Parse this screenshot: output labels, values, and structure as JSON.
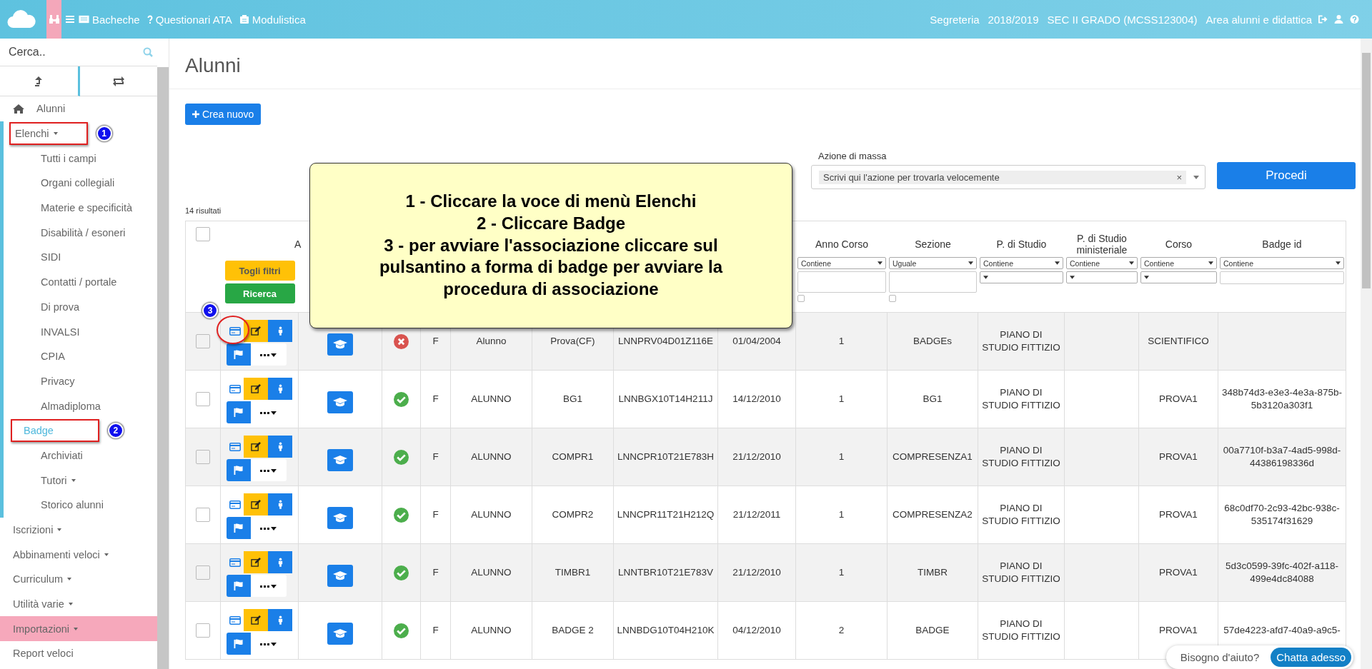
{
  "topbar": {
    "nav": [
      {
        "kind": "board",
        "label": "Bacheche"
      },
      {
        "kind": "question",
        "label": "Questionari ATA"
      },
      {
        "kind": "doc",
        "label": "Modulistica"
      }
    ],
    "info": [
      "Segreteria",
      "2018/2019",
      "SEC II GRADO (MCSS123004)",
      "Area alunni e didattica"
    ]
  },
  "sidebar": {
    "search_placeholder": "Cerca..",
    "tabs": [
      {
        "kind": "up",
        "selected": true
      },
      {
        "kind": "swap",
        "selected": false
      }
    ],
    "items": [
      {
        "label": "Alunni",
        "kind": "home",
        "dropdown": false,
        "selected": false,
        "highlighted": false
      },
      {
        "label": "Elenchi",
        "dropdown": true,
        "expanded": true,
        "selected": false,
        "highlighted": false,
        "annotation": "1",
        "children": [
          {
            "label": "Tutti i campi",
            "selected": false,
            "dropdown": false
          },
          {
            "label": "Organi collegiali",
            "selected": false,
            "dropdown": false
          },
          {
            "label": "Materie e specificità",
            "selected": false,
            "dropdown": false
          },
          {
            "label": "Disabilità / esoneri",
            "selected": false,
            "dropdown": false
          },
          {
            "label": "SIDI",
            "selected": false,
            "dropdown": false
          },
          {
            "label": "Contatti / portale",
            "selected": false,
            "dropdown": false
          },
          {
            "label": "Di prova",
            "selected": false,
            "dropdown": false
          },
          {
            "label": "INVALSI",
            "selected": false,
            "dropdown": false
          },
          {
            "label": "CPIA",
            "selected": false,
            "dropdown": false
          },
          {
            "label": "Privacy",
            "selected": false,
            "dropdown": false
          },
          {
            "label": "Almadiploma",
            "selected": false,
            "dropdown": false
          },
          {
            "label": "Badge",
            "selected": true,
            "dropdown": false,
            "annotation": "2"
          },
          {
            "label": "Archiviati",
            "selected": false,
            "dropdown": false
          },
          {
            "label": "Tutori",
            "selected": false,
            "dropdown": true
          },
          {
            "label": "Storico alunni",
            "selected": false,
            "dropdown": false
          }
        ]
      },
      {
        "label": "Iscrizioni",
        "dropdown": true,
        "selected": false,
        "highlighted": false
      },
      {
        "label": "Abbinamenti veloci",
        "dropdown": true,
        "selected": false,
        "highlighted": false
      },
      {
        "label": "Curriculum",
        "dropdown": true,
        "selected": false,
        "highlighted": false
      },
      {
        "label": "Utilità varie",
        "dropdown": true,
        "selected": false,
        "highlighted": false
      },
      {
        "label": "Importazioni",
        "dropdown": true,
        "selected": false,
        "highlighted": true
      },
      {
        "label": "Report veloci",
        "dropdown": false,
        "selected": false,
        "highlighted": false
      }
    ]
  },
  "page": {
    "title": "Alunni",
    "create_button": "Crea nuovo",
    "mass_action": {
      "label": "Azione di massa",
      "value": "Scrivi qui l'azione per trovarla velocemente",
      "clear": "×",
      "button": "Procedi"
    },
    "results": "14 risultati"
  },
  "table": {
    "columns": [
      {
        "kind": "select-all",
        "checked": false
      },
      {
        "kind": "actions",
        "buttons": [
          "Togli filtri",
          "Ricerca"
        ]
      },
      {
        "kind": "plain",
        "label": "A"
      },
      {
        "kind": "blank"
      },
      {
        "kind": "blank"
      },
      {
        "kind": "blank"
      },
      {
        "kind": "blank"
      },
      {
        "kind": "blank"
      },
      {
        "kind": "blank"
      },
      {
        "kind": "text-filter",
        "label": "Anno Corso",
        "operator": "Contiene",
        "checked": false
      },
      {
        "kind": "text-filter",
        "label": "Sezione",
        "operator": "Uguale",
        "checked": false
      },
      {
        "kind": "select-filter",
        "label": "P. di Studio",
        "operator": "Contiene"
      },
      {
        "kind": "select-filter",
        "label": "P. di Studio ministeriale",
        "operator": "Contiene"
      },
      {
        "kind": "select-filter",
        "label": "Corso",
        "operator": "Contiene"
      },
      {
        "kind": "input-filter",
        "label": "Badge id",
        "operator": "Contiene"
      }
    ],
    "rows": [
      {
        "checked": false,
        "valid": false,
        "annotation": "3",
        "cells": [
          null,
          null,
          null,
          null,
          "F",
          "Alunno",
          "Prova(CF)",
          "LNNPRV04D01Z116E",
          "01/04/2004",
          "1",
          "BADGEs",
          "PIANO DI STUDIO FITTIZIO",
          null,
          "SCIENTIFICO",
          null
        ]
      },
      {
        "checked": false,
        "valid": true,
        "cells": [
          null,
          null,
          null,
          null,
          "F",
          "ALUNNO",
          "BG1",
          "LNNBGX10T14H211J",
          "14/12/2010",
          "1",
          "BG1",
          "PIANO DI STUDIO FITTIZIO",
          null,
          "PROVA1",
          "348b74d3-e3e3-4e3a-875b-5b3120a303f1"
        ]
      },
      {
        "checked": false,
        "valid": true,
        "cells": [
          null,
          null,
          null,
          null,
          "F",
          "ALUNNO",
          "COMPR1",
          "LNNCPR10T21E783H",
          "21/12/2010",
          "1",
          "COMPRESENZA1",
          "PIANO DI STUDIO FITTIZIO",
          null,
          "PROVA1",
          "00a7710f-b3a7-4ad5-998d-44386198336d"
        ]
      },
      {
        "checked": false,
        "valid": true,
        "cells": [
          null,
          null,
          null,
          null,
          "F",
          "ALUNNO",
          "COMPR2",
          "LNNCPR11T21H212Q",
          "21/12/2011",
          "1",
          "COMPRESENZA2",
          "PIANO DI STUDIO FITTIZIO",
          null,
          "PROVA1",
          "68c0df70-2c93-42bc-938c-535174f31629"
        ]
      },
      {
        "checked": false,
        "valid": true,
        "cells": [
          null,
          null,
          null,
          null,
          "F",
          "ALUNNO",
          "TIMBR1",
          "LNNTBR10T21E783V",
          "21/12/2010",
          "1",
          "TIMBR",
          "PIANO DI STUDIO FITTIZIO",
          null,
          "PROVA1",
          "5d3c0599-39fc-402f-a118-499e4dc84088"
        ]
      },
      {
        "checked": false,
        "valid": true,
        "cells": [
          null,
          null,
          null,
          null,
          "F",
          "ALUNNO",
          "BADGE 2",
          "LNNBDG10T04H210K",
          "04/12/2010",
          "2",
          "BADGE",
          "PIANO DI STUDIO FITTIZIO",
          null,
          "PROVA1",
          "57de4223-afd7-40a9-a9c5-"
        ]
      }
    ]
  },
  "callout": [
    "1 - Cliccare la voce di menù Elenchi",
    "2 - Cliccare Badge",
    "3 - per avviare l'associazione cliccare sul pulsantino a forma di badge per avviare la procedura di associazione"
  ],
  "chat": {
    "prompt": "Bisogno d'aiuto?",
    "button": "Chatta adesso"
  }
}
